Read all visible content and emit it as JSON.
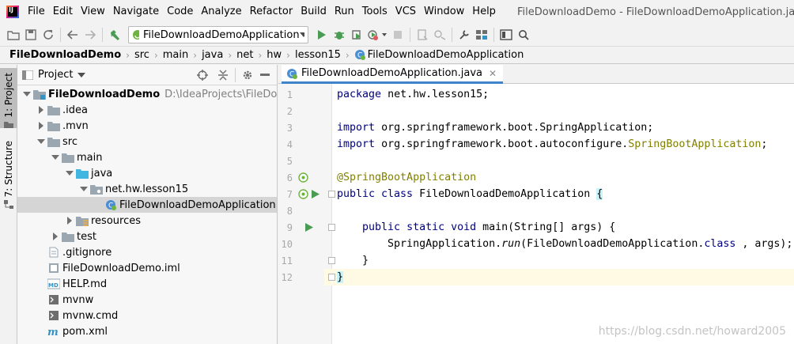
{
  "menubar": {
    "items": [
      "File",
      "Edit",
      "View",
      "Navigate",
      "Code",
      "Analyze",
      "Refactor",
      "Build",
      "Run",
      "Tools",
      "VCS",
      "Window",
      "Help"
    ],
    "window_title": "FileDownloadDemo - FileDownloadDemoApplication.java - Inte"
  },
  "toolbar": {
    "run_config": "FileDownloadDemoApplication",
    "icons": [
      "open-folder-icon",
      "save-icon",
      "sync-icon",
      "back-icon",
      "forward-icon",
      "build-hammer-icon",
      "run-icon",
      "debug-icon",
      "coverage-icon",
      "profile-icon",
      "stop-icon",
      "vcs-update-icon",
      "vcs-commit-icon",
      "settings-wrench-icon",
      "project-structure-icon",
      "terminal-frame-icon",
      "search-icon"
    ]
  },
  "breadcrumbs": [
    "FileDownloadDemo",
    "src",
    "main",
    "java",
    "net",
    "hw",
    "lesson15",
    "FileDownloadDemoApplication"
  ],
  "side_tabs": {
    "project": "1: Project",
    "structure": "7: Structure"
  },
  "project_panel": {
    "title": "Project",
    "tree": [
      {
        "label": "FileDownloadDemo",
        "path": "D:\\IdeaProjects\\FileDownloa",
        "depth": 0,
        "kind": "module",
        "open": true,
        "bold": true
      },
      {
        "label": ".idea",
        "depth": 1,
        "kind": "folder",
        "open": false
      },
      {
        "label": ".mvn",
        "depth": 1,
        "kind": "folder",
        "open": false
      },
      {
        "label": "src",
        "depth": 1,
        "kind": "folder",
        "open": true
      },
      {
        "label": "main",
        "depth": 2,
        "kind": "folder",
        "open": true
      },
      {
        "label": "java",
        "depth": 3,
        "kind": "source-folder",
        "open": true
      },
      {
        "label": "net.hw.lesson15",
        "depth": 4,
        "kind": "package",
        "open": true
      },
      {
        "label": "FileDownloadDemoApplication",
        "depth": 5,
        "kind": "spring-class",
        "selected": true
      },
      {
        "label": "resources",
        "depth": 3,
        "kind": "resources-folder",
        "open": false
      },
      {
        "label": "test",
        "depth": 2,
        "kind": "folder",
        "open": false
      },
      {
        "label": ".gitignore",
        "depth": 1,
        "kind": "file"
      },
      {
        "label": "FileDownloadDemo.iml",
        "depth": 1,
        "kind": "iml-file"
      },
      {
        "label": "HELP.md",
        "depth": 1,
        "kind": "md-file"
      },
      {
        "label": "mvnw",
        "depth": 1,
        "kind": "script-file"
      },
      {
        "label": "mvnw.cmd",
        "depth": 1,
        "kind": "script-file"
      },
      {
        "label": "pom.xml",
        "depth": 1,
        "kind": "maven-file"
      }
    ]
  },
  "editor": {
    "tab_label": "FileDownloadDemoApplication.java",
    "current_line": 12,
    "lines": [
      {
        "n": "1",
        "tokens": [
          [
            "kw",
            "package"
          ],
          [
            "",
            "net.hw.lesson15;"
          ]
        ]
      },
      {
        "n": "2",
        "tokens": []
      },
      {
        "n": "3",
        "tokens": [
          [
            "kw",
            "import"
          ],
          [
            "",
            "org.springframework.boot.SpringApplication;"
          ]
        ]
      },
      {
        "n": "4",
        "tokens": [
          [
            "kw",
            "import"
          ],
          [
            "",
            "org.springframework.boot.autoconfigure."
          ],
          [
            "ann",
            "SpringBootApplication"
          ],
          [
            "",
            ";"
          ]
        ]
      },
      {
        "n": "5",
        "tokens": []
      },
      {
        "n": "6",
        "tokens": [
          [
            "ann",
            "@SpringBootApplication"
          ]
        ]
      },
      {
        "n": "7",
        "tokens": [
          [
            "kw",
            "public class"
          ],
          [
            "",
            " FileDownloadDemoApplication "
          ],
          [
            "brace",
            "{"
          ]
        ]
      },
      {
        "n": "8",
        "tokens": []
      },
      {
        "n": "9",
        "tokens": [
          [
            "",
            "    "
          ],
          [
            "kw",
            "public static void"
          ],
          [
            "",
            " main(String[] args) {"
          ]
        ]
      },
      {
        "n": "10",
        "tokens": [
          [
            "",
            "        SpringApplication."
          ],
          [
            "it",
            "run"
          ],
          [
            "",
            "(FileDownloadDemoApplication."
          ],
          [
            "kw",
            "class"
          ],
          [
            "",
            ", args);"
          ]
        ]
      },
      {
        "n": "11",
        "tokens": [
          [
            "",
            "    }"
          ]
        ]
      },
      {
        "n": "12",
        "tokens": [
          [
            "brace",
            "}"
          ]
        ]
      }
    ]
  },
  "watermark": "https://blog.csdn.net/howard2005",
  "colors": {
    "keyword": "#000080",
    "annotation": "#808000",
    "run_green": "#499c54",
    "selection": "#d5d5d5",
    "tab_underline": "#4083c9"
  }
}
